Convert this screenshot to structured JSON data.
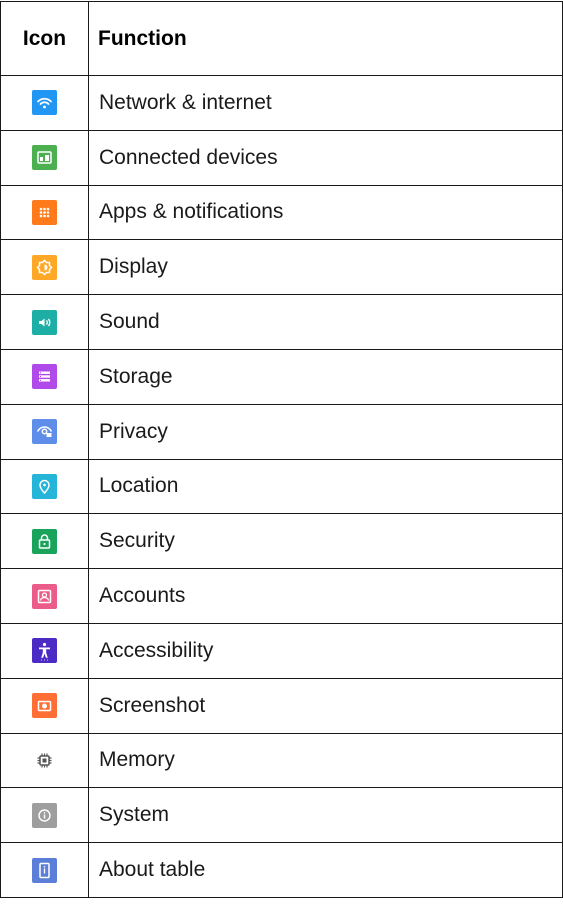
{
  "table": {
    "headers": [
      "Icon",
      "Function"
    ],
    "rows": [
      {
        "icon": "wifi-icon",
        "color": "#2196F3",
        "label": "Network & internet"
      },
      {
        "icon": "connected-devices-icon",
        "color": "#4CAF50",
        "label": "Connected devices"
      },
      {
        "icon": "apps-grid-icon",
        "color": "#FF7A1A",
        "label": "Apps & notifications"
      },
      {
        "icon": "brightness-icon",
        "color": "#FFA726",
        "label": "Display"
      },
      {
        "icon": "volume-icon",
        "color": "#1DAFA5",
        "label": "Sound"
      },
      {
        "icon": "storage-icon",
        "color": "#B04AE8",
        "label": "Storage"
      },
      {
        "icon": "privacy-eye-icon",
        "color": "#5E8EEA",
        "label": "Privacy"
      },
      {
        "icon": "location-pin-icon",
        "color": "#25B5D8",
        "label": "Location"
      },
      {
        "icon": "lock-icon",
        "color": "#19A35B",
        "label": "Security"
      },
      {
        "icon": "account-icon",
        "color": "#EC5C8B",
        "label": "Accounts"
      },
      {
        "icon": "accessibility-icon",
        "color": "#4B2BC4",
        "label": "Accessibility"
      },
      {
        "icon": "camera-icon",
        "color": "#FF6E35",
        "label": "Screenshot"
      },
      {
        "icon": "memory-chip-icon",
        "color": "#ffffff",
        "label": "Memory"
      },
      {
        "icon": "info-icon",
        "color": "#9E9E9E",
        "label": "System"
      },
      {
        "icon": "tablet-info-icon",
        "color": "#5B7FD8",
        "label": "About table"
      }
    ]
  }
}
